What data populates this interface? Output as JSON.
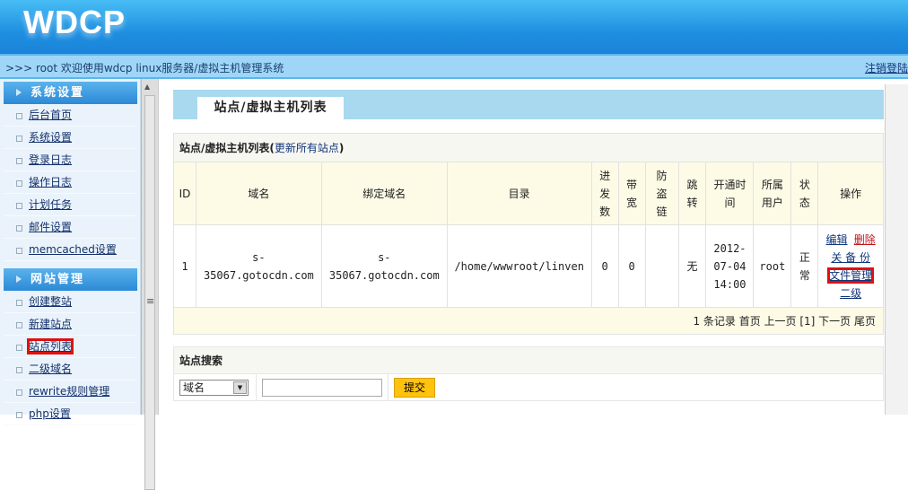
{
  "header": {
    "logo": "WDCP",
    "welcome": ">>> root 欢迎使用wdcp linux服务器/虚拟主机管理系统",
    "logout": "注销登陆"
  },
  "sidebar": {
    "sections": [
      {
        "title": "系统设置",
        "items": [
          "后台首页",
          "系统设置",
          "登录日志",
          "操作日志",
          "计划任务",
          "邮件设置",
          "memcached设置"
        ]
      },
      {
        "title": "网站管理",
        "items": [
          "创建整站",
          "新建站点",
          "站点列表",
          "二级域名",
          "rewrite规则管理",
          "php设置"
        ]
      }
    ]
  },
  "main": {
    "tab": "站点/虚拟主机列表",
    "table": {
      "caption": "站点/虚拟主机列表",
      "caption_link": "更新所有站点",
      "headers": [
        "ID",
        "域名",
        "绑定域名",
        "目录",
        "进发数",
        "带宽",
        "防盗链",
        "跳转",
        "开通时间",
        "所属用户",
        "状态",
        "操作"
      ],
      "rows": [
        {
          "id": "1",
          "domain": "s-35067.gotocdn.com",
          "bind": "s-35067.gotocdn.com",
          "dir": "/home/wwwroot/linven",
          "conn": "0",
          "bw": "0",
          "hotlink": "",
          "redirect": "无",
          "time": "2012-07-04 14:00",
          "user": "root",
          "status": "正常",
          "ops": {
            "edit": "编辑",
            "delete": "删除",
            "backup": "关 备 份",
            "files": "文件管理",
            "sub": "二级"
          }
        }
      ],
      "pager": "1 条记录 首页 上一页 [1] 下一页 尾页"
    },
    "search": {
      "title": "站点搜索",
      "select": "域名",
      "input": "",
      "submit": "提交"
    }
  }
}
